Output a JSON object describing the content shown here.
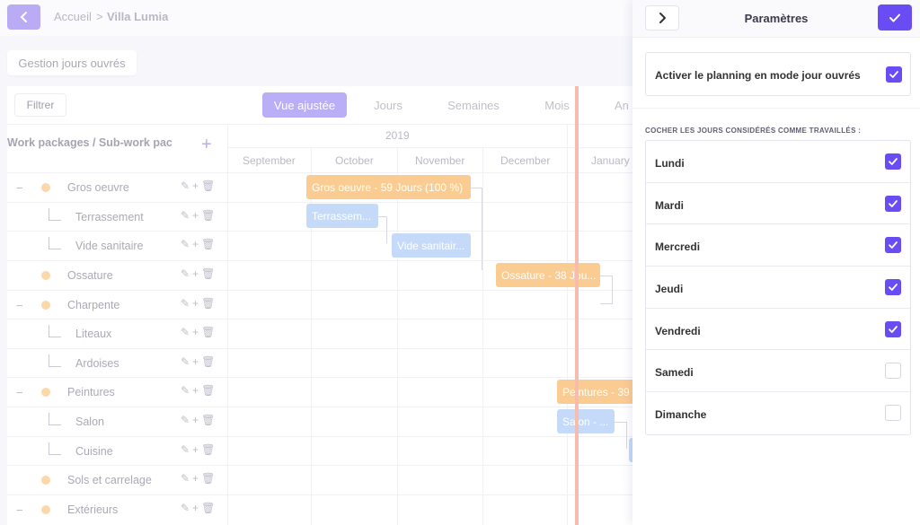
{
  "breadcrumb": {
    "home": "Accueil",
    "separator": ">",
    "project": "Villa Lumia"
  },
  "toolbar": {
    "management_button": "Gestion jours ouvrés",
    "filter_button": "Filtrer"
  },
  "view_tabs": [
    "Vue ajustée",
    "Jours",
    "Semaines",
    "Mois",
    "An"
  ],
  "tree": {
    "header": "Work packages / Sub-work packages",
    "add_symbol": "+",
    "rows": [
      {
        "label": "Gros oeuvre",
        "collapse": "−"
      },
      {
        "label": "Terrassement"
      },
      {
        "label": "Vide sanitaire"
      },
      {
        "label": "Ossature"
      },
      {
        "label": "Charpente",
        "collapse": "−"
      },
      {
        "label": "Liteaux"
      },
      {
        "label": "Ardoises"
      },
      {
        "label": "Peintures",
        "collapse": "−"
      },
      {
        "label": "Salon"
      },
      {
        "label": "Cuisine"
      },
      {
        "label": "Sols et carrelage"
      },
      {
        "label": "Extérieurs",
        "collapse": "−"
      }
    ],
    "row_actions": "✎+🗑"
  },
  "timeline": {
    "year": "2019",
    "months": [
      "September",
      "October",
      "November",
      "December",
      "January"
    ],
    "bars": [
      {
        "label": "Gros oeuvre - 59 Jours (100 %)"
      },
      {
        "label": "Terrassem..."
      },
      {
        "label": "Vide sanitair..."
      },
      {
        "label": "Ossature - 38 Jou..."
      },
      {
        "label": "Peintures - 39"
      },
      {
        "label": "Salon - ..."
      }
    ]
  },
  "settings": {
    "title": "Paramètres",
    "working_day_mode_label": "Activer le planning en mode jour ouvrés",
    "working_day_mode_checked": true,
    "section_title": "COCHER LES JOURS CONSIDÉRÉS COMME TRAVAILLÉS :",
    "days": [
      {
        "label": "Lundi",
        "checked": true
      },
      {
        "label": "Mardi",
        "checked": true
      },
      {
        "label": "Mercredi",
        "checked": true
      },
      {
        "label": "Jeudi",
        "checked": true
      },
      {
        "label": "Vendredi",
        "checked": true
      },
      {
        "label": "Samedi",
        "checked": false
      },
      {
        "label": "Dimanche",
        "checked": false
      }
    ]
  },
  "colors": {
    "accent": "#6a4cf5",
    "accent_faded": "#baaef6",
    "task_orange": "#fbcc92",
    "task_blue": "#c5daf9",
    "today_line": "#f7bcae"
  }
}
